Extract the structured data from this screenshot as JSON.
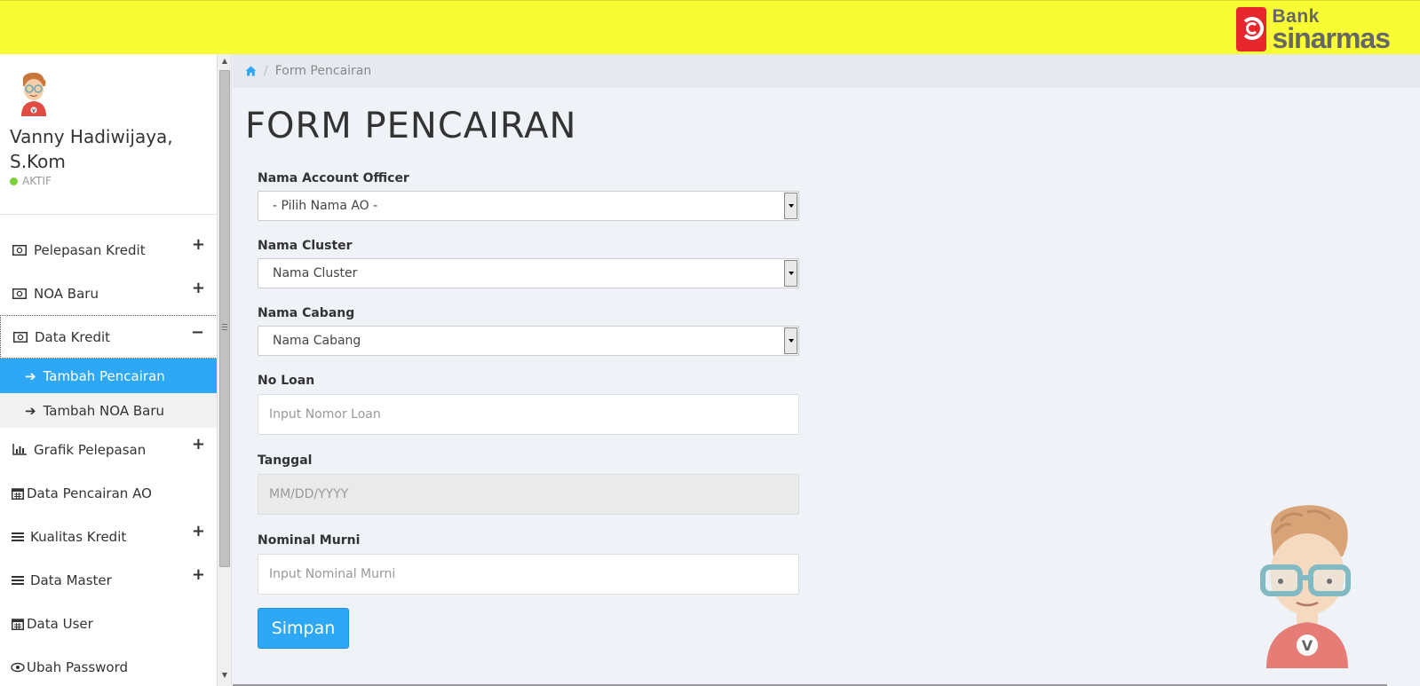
{
  "brand": {
    "bank_label": "Bank",
    "name_label": "sinarmas",
    "primary_color": "#e8262d",
    "topbar_color": "#f7fd32"
  },
  "profile": {
    "name": "Vanny Hadiwijaya, S.Kom",
    "status": "AKTIF",
    "status_color": "#7cd13a"
  },
  "sidebar": {
    "items": [
      {
        "label": "Pelepasan Kredit",
        "icon": "money-icon",
        "toggle": "+"
      },
      {
        "label": "NOA Baru",
        "icon": "money-icon",
        "toggle": "+"
      },
      {
        "label": "Data Kredit",
        "icon": "money-icon",
        "toggle": "−"
      },
      {
        "label": "Grafik Pelepasan",
        "icon": "bar-chart-icon",
        "toggle": "+"
      },
      {
        "label": "Data Pencairan AO",
        "icon": "calendar-icon",
        "toggle": ""
      },
      {
        "label": "Kualitas Kredit",
        "icon": "list-icon",
        "toggle": "+"
      },
      {
        "label": "Data Master",
        "icon": "list-icon",
        "toggle": "+"
      },
      {
        "label": "Data User",
        "icon": "calendar-icon",
        "toggle": ""
      },
      {
        "label": "Ubah Password",
        "icon": "eye-icon",
        "toggle": ""
      }
    ],
    "submenu": [
      {
        "label": "Tambah Pencairan",
        "selected": true
      },
      {
        "label": "Tambah NOA Baru",
        "selected": false
      }
    ],
    "accent_color": "#2ea7f5"
  },
  "breadcrumb": {
    "current": "Form Pencairan"
  },
  "page": {
    "title": "FORM PENCAIRAN"
  },
  "form": {
    "account_officer": {
      "label": "Nama Account Officer",
      "value": "- Pilih Nama AO -"
    },
    "cluster": {
      "label": "Nama Cluster",
      "value": "Nama Cluster"
    },
    "cabang": {
      "label": "Nama Cabang",
      "value": "Nama Cabang"
    },
    "no_loan": {
      "label": "No Loan",
      "placeholder": "Input Nomor Loan"
    },
    "tanggal": {
      "label": "Tanggal",
      "placeholder": "MM/DD/YYYY"
    },
    "nominal": {
      "label": "Nominal Murni",
      "placeholder": "Input Nominal Murni"
    },
    "submit_label": "Simpan"
  }
}
